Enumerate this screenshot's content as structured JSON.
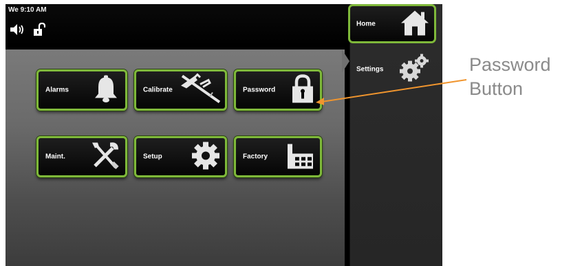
{
  "status": {
    "time": "We 9:10 AM",
    "icons": [
      "speaker-icon",
      "unlock-icon"
    ]
  },
  "nav": {
    "home_label": "Home",
    "settings_label": "Settings"
  },
  "buttons": [
    {
      "label": "Alarms",
      "icon": "bell-icon"
    },
    {
      "label": "Calibrate",
      "icon": "caliper-icon"
    },
    {
      "label": "Password",
      "icon": "lock-icon"
    },
    {
      "label": "Maint.",
      "icon": "tools-icon"
    },
    {
      "label": "Setup",
      "icon": "gear-icon"
    },
    {
      "label": "Factory",
      "icon": "factory-icon"
    }
  ],
  "callout": {
    "line1": "Password",
    "line2": "Button"
  },
  "colors": {
    "button_border": "#7fb93a",
    "callout_arrow": "#f0952e"
  }
}
